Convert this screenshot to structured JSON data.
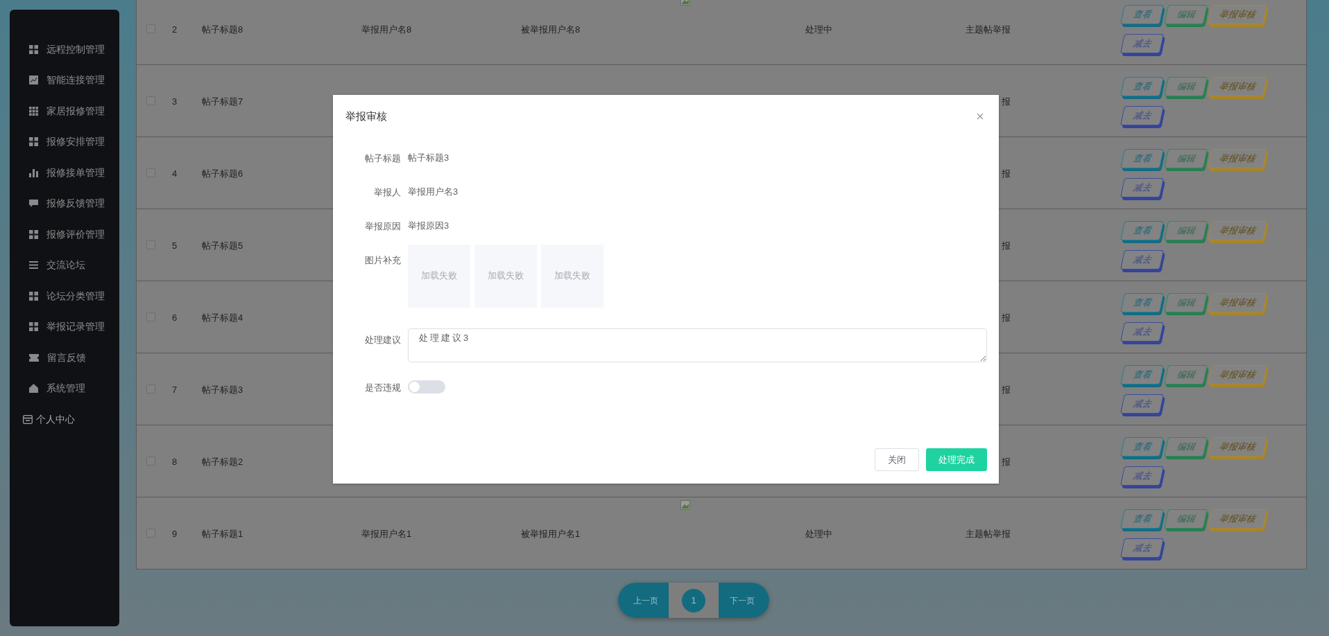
{
  "sidebar": {
    "items": [
      {
        "label": "远程控制管理",
        "kind": "menu"
      },
      {
        "label": "智能连接管理",
        "kind": "menu"
      },
      {
        "label": "家居报修管理",
        "kind": "menu"
      },
      {
        "label": "报修安排管理",
        "kind": "menu"
      },
      {
        "label": "报修接单管理",
        "kind": "menu"
      },
      {
        "label": "报修反馈管理",
        "kind": "menu"
      },
      {
        "label": "报修评价管理",
        "kind": "menu"
      },
      {
        "label": "交流论坛",
        "kind": "menu"
      },
      {
        "label": "论坛分类管理",
        "kind": "menu"
      },
      {
        "label": "举报记录管理",
        "kind": "menu"
      },
      {
        "label": "留言反馈",
        "kind": "menu"
      },
      {
        "label": "系统管理",
        "kind": "menu"
      },
      {
        "label": "个人中心",
        "kind": "plain"
      }
    ]
  },
  "table": {
    "rows": [
      {
        "checked": false,
        "index": "2",
        "title": "帖子标题8",
        "reporter": "举报用户名8",
        "reported": "被举报用户名8",
        "status": "处理中",
        "type": "主题帖举报",
        "actions": [
          {
            "label": "查看",
            "kind": "view"
          },
          {
            "label": "编辑",
            "kind": "edit"
          },
          {
            "label": "举报审核",
            "kind": "review"
          },
          {
            "label": "减去",
            "kind": "remove"
          }
        ]
      },
      {
        "checked": false,
        "index": "3",
        "title": "帖子标题7",
        "type": "报",
        "actions": [
          {
            "label": "查看",
            "kind": "view"
          },
          {
            "label": "编辑",
            "kind": "edit"
          },
          {
            "label": "举报审核",
            "kind": "review"
          },
          {
            "label": "减去",
            "kind": "remove"
          }
        ]
      },
      {
        "checked": false,
        "index": "4",
        "title": "帖子标题6",
        "type": "报",
        "actions": [
          {
            "label": "查看",
            "kind": "view"
          },
          {
            "label": "编辑",
            "kind": "edit"
          },
          {
            "label": "举报审核",
            "kind": "review"
          },
          {
            "label": "减去",
            "kind": "remove"
          }
        ]
      },
      {
        "checked": false,
        "index": "5",
        "title": "帖子标题5",
        "type": "报",
        "actions": [
          {
            "label": "查看",
            "kind": "view"
          },
          {
            "label": "编辑",
            "kind": "edit"
          },
          {
            "label": "举报审核",
            "kind": "review"
          },
          {
            "label": "减去",
            "kind": "remove"
          }
        ]
      },
      {
        "checked": false,
        "index": "6",
        "title": "帖子标题4",
        "type": "报",
        "actions": [
          {
            "label": "查看",
            "kind": "view"
          },
          {
            "label": "编辑",
            "kind": "edit"
          },
          {
            "label": "举报审核",
            "kind": "review"
          },
          {
            "label": "减去",
            "kind": "remove"
          }
        ]
      },
      {
        "checked": false,
        "index": "7",
        "title": "帖子标题3",
        "type": "报",
        "actions": [
          {
            "label": "查看",
            "kind": "view"
          },
          {
            "label": "编辑",
            "kind": "edit"
          },
          {
            "label": "举报审核",
            "kind": "review"
          },
          {
            "label": "减去",
            "kind": "remove"
          }
        ]
      },
      {
        "checked": false,
        "index": "8",
        "title": "帖子标题2",
        "type": "报",
        "actions": [
          {
            "label": "查看",
            "kind": "view"
          },
          {
            "label": "编辑",
            "kind": "edit"
          },
          {
            "label": "举报审核",
            "kind": "review"
          },
          {
            "label": "减去",
            "kind": "remove"
          }
        ]
      },
      {
        "checked": false,
        "index": "9",
        "title": "帖子标题1",
        "reporter": "举报用户名1",
        "reported": "被举报用户名1",
        "status": "处理中",
        "type": "主题帖举报",
        "actions": [
          {
            "label": "查看",
            "kind": "view"
          },
          {
            "label": "编辑",
            "kind": "edit"
          },
          {
            "label": "举报审核",
            "kind": "review"
          },
          {
            "label": "减去",
            "kind": "remove"
          }
        ]
      }
    ]
  },
  "pagination": {
    "prev": "上一页",
    "pages": [
      {
        "label": "1",
        "selected": true
      }
    ],
    "next": "下一页"
  },
  "modal": {
    "title": "举报审核",
    "fields": [
      {
        "label": "帖子标题",
        "kind": "text",
        "value": "帖子标题3"
      },
      {
        "label": "举报人",
        "kind": "text",
        "value": "举报用户名3"
      },
      {
        "label": "举报原因",
        "kind": "text",
        "value": "举报原因3"
      },
      {
        "label": "图片补充",
        "kind": "images",
        "images": [
          "加载失败",
          "加载失败",
          "加载失败"
        ]
      },
      {
        "label": "处理建议",
        "kind": "textarea",
        "value": "处理建议3"
      },
      {
        "label": "是否违规",
        "kind": "switch",
        "on": false
      }
    ],
    "buttons": [
      {
        "label": "关闭",
        "kind": "default"
      },
      {
        "label": "处理完成",
        "kind": "primary"
      }
    ]
  }
}
